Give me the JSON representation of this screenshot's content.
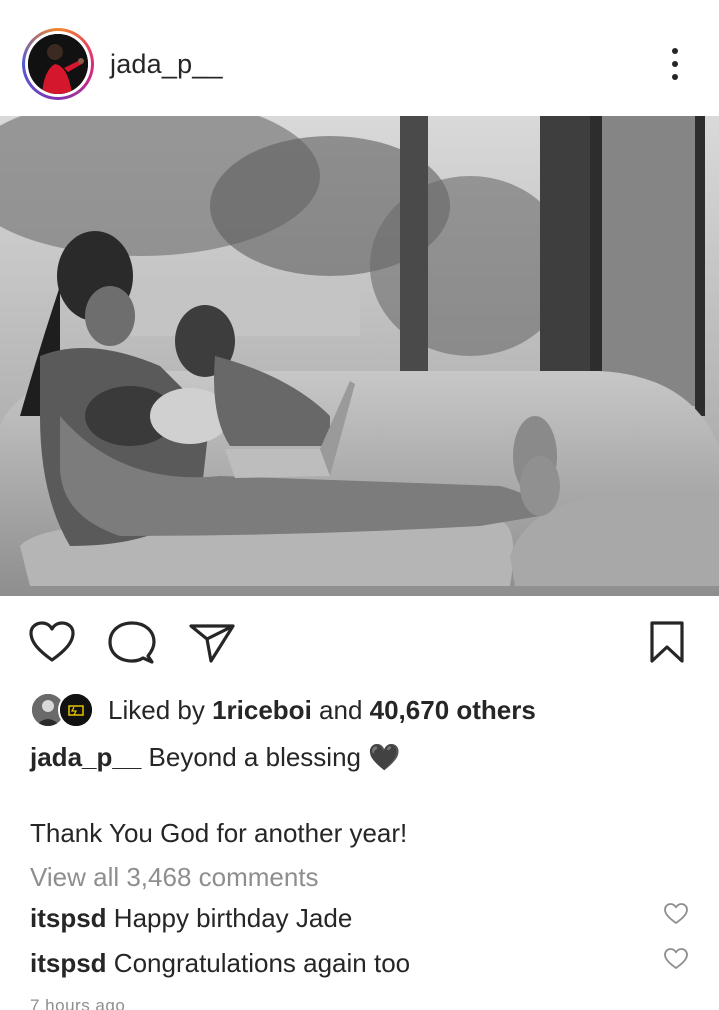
{
  "post": {
    "username": "jada_p__",
    "photo_alt": "black and white photo"
  },
  "likes": {
    "prefix": "Liked by ",
    "user": "1riceboi",
    "middle": " and ",
    "others": "40,670 others"
  },
  "caption": {
    "username": "jada_p__",
    "text": " Beyond a blessing 🖤",
    "line2": "Thank You God for another year!"
  },
  "view_all_comments": "View all 3,468 comments",
  "comments": [
    {
      "username": "itspsd",
      "text": " Happy birthday Jade"
    },
    {
      "username": "itspsd",
      "text": " Congratulations again too"
    }
  ],
  "timestamp": "7 hours ago",
  "icons": {
    "more": "more-vertical-icon",
    "like": "heart-icon",
    "comment": "comment-icon",
    "share": "send-icon",
    "save": "bookmark-icon"
  },
  "colors": {
    "text": "#262626",
    "muted": "#8e8e8e",
    "ring_start": "#f58529",
    "ring_end": "#dd2a7b"
  }
}
